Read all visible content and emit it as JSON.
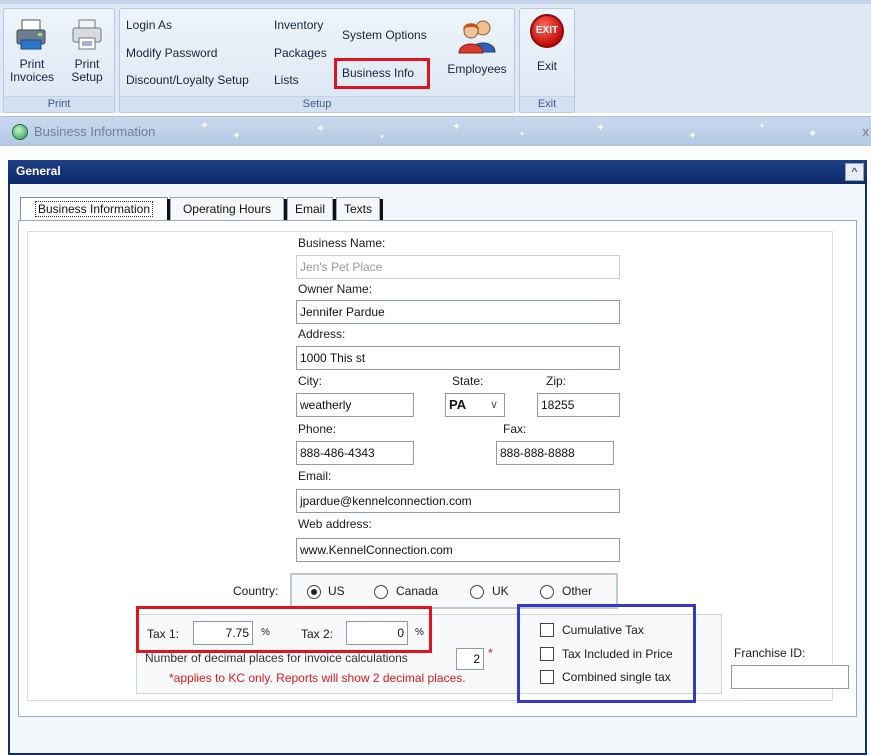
{
  "ribbon": {
    "print_group": {
      "label": "Print",
      "print_invoices": "Print Invoices",
      "print_setup": "Print Setup"
    },
    "setup_group": {
      "label": "Setup",
      "login_as": "Login As",
      "modify_password": "Modify Password",
      "discount_loyalty_setup": "Discount/Loyalty Setup",
      "inventory": "Inventory",
      "packages": "Packages",
      "lists": "Lists",
      "system_options": "System Options",
      "business_info": "Business Info",
      "employees": "Employees"
    },
    "exit_group": {
      "label": "Exit",
      "exit_icon_text": "EXIT",
      "exit": "Exit"
    }
  },
  "window": {
    "title": "Business Information",
    "close_glyph": "x"
  },
  "panel": {
    "title": "General",
    "collapse_glyph": "^"
  },
  "tabs": [
    {
      "label": "Business Information",
      "active": true
    },
    {
      "label": "Operating Hours",
      "active": false
    },
    {
      "label": "Email",
      "active": false
    },
    {
      "label": "Texts",
      "active": false
    }
  ],
  "form": {
    "business_name": {
      "label": "Business Name:",
      "value": "Jen's Pet Place"
    },
    "owner_name": {
      "label": "Owner Name:",
      "value": "Jennifer Pardue"
    },
    "address": {
      "label": "Address:",
      "value": "1000 This st"
    },
    "city": {
      "label": "City:",
      "value": "weatherly"
    },
    "state": {
      "label": "State:",
      "value": "PA"
    },
    "zip": {
      "label": "Zip:",
      "value": "18255"
    },
    "phone": {
      "label": "Phone:",
      "value": "888-486-4343"
    },
    "fax": {
      "label": "Fax:",
      "value": "888-888-8888"
    },
    "email": {
      "label": "Email:",
      "value": "jpardue@kennelconnection.com"
    },
    "web_address": {
      "label": "Web address:",
      "value": "www.KennelConnection.com"
    },
    "country": {
      "label": "Country:",
      "options": [
        "US",
        "Canada",
        "UK",
        "Other"
      ],
      "selected": "US"
    },
    "tax1": {
      "label": "Tax 1:",
      "value": "7.75",
      "unit": "%"
    },
    "tax2": {
      "label": "Tax 2:",
      "value": "0",
      "unit": "%"
    },
    "decimal_places": {
      "label": "Number of decimal places for invoice calculations",
      "value": "2",
      "required_mark": "*"
    },
    "decimal_note": "*applies to KC only. Reports will show 2 decimal places.",
    "checkboxes": [
      {
        "label": "Cumulative Tax",
        "checked": false
      },
      {
        "label": "Tax Included in Price",
        "checked": false
      },
      {
        "label": "Combined single tax",
        "checked": false
      }
    ],
    "franchise_id": {
      "label": "Franchise ID:",
      "value": ""
    }
  },
  "colors": {
    "highlight_red": "#e0141e",
    "highlight_blue": "#3838c8",
    "panel_header": "#0d2a6a",
    "required_text": "#e01a1a"
  }
}
